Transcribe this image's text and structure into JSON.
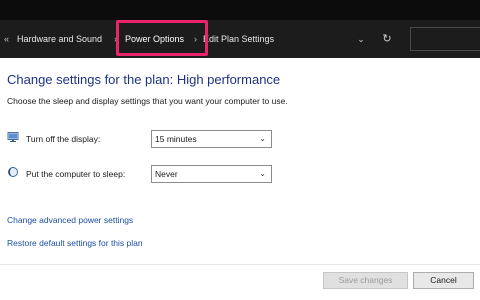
{
  "breadcrumb": {
    "back_glyph": "«",
    "items": [
      "Hardware and Sound",
      "Power Options",
      "Edit Plan Settings"
    ],
    "separator": "›",
    "highlight_color": "#e8246b"
  },
  "toolbar": {
    "dropdown_icon": "chevron-down-icon",
    "dropdown_glyph": "⌄",
    "refresh_icon": "refresh-icon",
    "refresh_glyph": "↻"
  },
  "main": {
    "heading": "Change settings for the plan: High performance",
    "subheading": "Choose the sleep and display settings that you want your computer to use.",
    "settings": [
      {
        "icon": "monitor-icon",
        "label": "Turn off the display:",
        "value": "15 minutes"
      },
      {
        "icon": "moon-icon",
        "label": "Put the computer to sleep:",
        "value": "Never"
      }
    ],
    "links": [
      "Change advanced power settings",
      "Restore default settings for this plan"
    ]
  },
  "footer": {
    "save_label": "Save changes",
    "cancel_label": "Cancel"
  }
}
